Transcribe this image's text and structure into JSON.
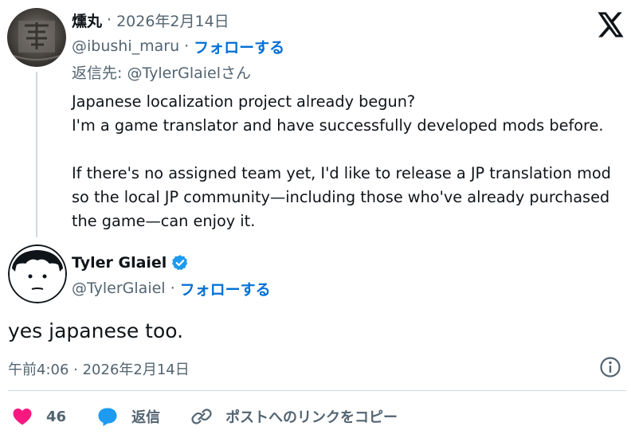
{
  "reply_tweet": {
    "name": "燻丸",
    "separator": "·",
    "date": "2026年2月14日",
    "handle": "@ibushi_maru",
    "follow_label": "フォローする",
    "reply_to_prefix": "返信先: ",
    "reply_to_handle": "@TylerGlaielさん",
    "body_lines": [
      "Japanese localization project already begun?",
      "I'm a game translator and have successfully developed mods before.",
      "",
      "If there's no assigned team yet, I'd like to release a JP translation mod",
      "so the local JP community—including those who've already purchased",
      "the game—can enjoy it."
    ]
  },
  "main_tweet": {
    "name": "Tyler Glaiel",
    "verified": true,
    "handle": "@TylerGlaiel",
    "separator": "·",
    "follow_label": "フォローする",
    "text": "yes japanese too.",
    "timestamp": "午前4:06 · 2026年2月14日"
  },
  "actions": {
    "like_count": "46",
    "reply_label": "返信",
    "copy_link_label": "ポストへのリンクをコピー"
  },
  "colors": {
    "text": "#0f1419",
    "secondary": "#536471",
    "link": "#006fd6",
    "like": "#f91880",
    "reply": "#1d9bf0",
    "verified": "#1d9bf0",
    "border": "#cfd9de"
  },
  "icons": [
    "x-logo-icon",
    "verified-badge-icon",
    "info-icon",
    "heart-icon",
    "reply-bubble-icon",
    "link-icon"
  ]
}
